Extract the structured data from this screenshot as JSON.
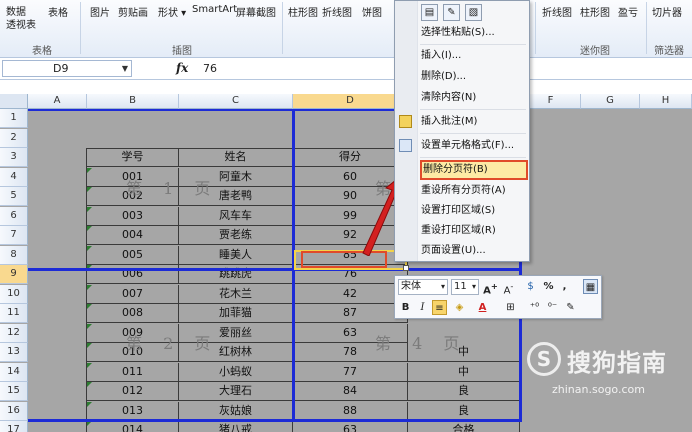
{
  "ribbon": {
    "buttons": [
      {
        "id": "data-pivot",
        "label": "数据\n透视表"
      },
      {
        "id": "table",
        "label": "表格"
      },
      {
        "id": "picture",
        "label": "图片"
      },
      {
        "id": "clipart",
        "label": "剪贴画"
      },
      {
        "id": "shapes",
        "label": "形状"
      },
      {
        "id": "smartart",
        "label": "SmartArt"
      },
      {
        "id": "screenshot",
        "label": "屏幕截图"
      },
      {
        "id": "column-chart",
        "label": "柱形图"
      },
      {
        "id": "line-chart",
        "label": "折线图"
      },
      {
        "id": "pie-chart",
        "label": "饼图"
      },
      {
        "id": "spark-line",
        "label": "折线图"
      },
      {
        "id": "spark-column",
        "label": "柱形图"
      },
      {
        "id": "win-loss",
        "label": "盈亏"
      },
      {
        "id": "slicer",
        "label": "切片器"
      }
    ],
    "groups": {
      "tables": "表格",
      "illustrations": "插图",
      "sparklines": "迷你图",
      "filter": "筛选器"
    }
  },
  "formula_bar": {
    "name_box": "D9",
    "fx": "fx",
    "value": "76"
  },
  "columns": [
    "A",
    "B",
    "C",
    "D",
    "E",
    "F",
    "G",
    "H"
  ],
  "rows": [
    "1",
    "2",
    "3",
    "4",
    "5",
    "6",
    "7",
    "8",
    "9",
    "10",
    "11",
    "12",
    "13",
    "14",
    "15",
    "16",
    "17"
  ],
  "table": {
    "headers": [
      "学号",
      "姓名",
      "得分"
    ],
    "rows": [
      [
        "001",
        "阿童木",
        "60"
      ],
      [
        "002",
        "唐老鸭",
        "90"
      ],
      [
        "003",
        "风车车",
        "99"
      ],
      [
        "004",
        "贾老练",
        "92"
      ],
      [
        "005",
        "睡美人",
        "85"
      ],
      [
        "006",
        "跳跳虎",
        "76"
      ],
      [
        "007",
        "花木兰",
        "42"
      ],
      [
        "008",
        "加菲猫",
        "87"
      ],
      [
        "009",
        "爱丽丝",
        "63"
      ],
      [
        "010",
        "红树林",
        "78"
      ],
      [
        "011",
        "小蚂蚁",
        "77"
      ],
      [
        "012",
        "大理石",
        "84"
      ],
      [
        "013",
        "灰姑娘",
        "88"
      ],
      [
        "014",
        "猪八戒",
        "63"
      ]
    ],
    "e_values": {
      "13": "中",
      "14": "中",
      "15": "良",
      "16": "良",
      "17": "合格"
    }
  },
  "watermarks": {
    "page1": "第 1 页",
    "page2": "第 2 页",
    "page4": "第 4 页",
    "page3_partial": "第"
  },
  "context_menu": {
    "items": [
      {
        "label": "选择性粘贴(S)..."
      },
      {
        "label": "插入(I)..."
      },
      {
        "label": "删除(D)..."
      },
      {
        "label": "清除内容(N)"
      },
      {
        "label": "插入批注(M)"
      },
      {
        "label": "设置单元格格式(F)..."
      },
      {
        "label": "删除分页符(B)"
      },
      {
        "label": "重设所有分页符(A)"
      },
      {
        "label": "设置打印区域(S)"
      },
      {
        "label": "重设打印区域(R)"
      },
      {
        "label": "页面设置(U)..."
      }
    ]
  },
  "mini_toolbar": {
    "font": "宋体",
    "size": "11",
    "bold": "B",
    "italic": "I",
    "percent": "%",
    "comma": ","
  },
  "logo": {
    "text": "搜狗指南",
    "url": "zhinan.sogo.com"
  },
  "colors": {
    "page_break": "#1c2bd6",
    "highlight": "#e04a2a",
    "arrow": "#d32020",
    "selected_header": "#f9d98f"
  }
}
